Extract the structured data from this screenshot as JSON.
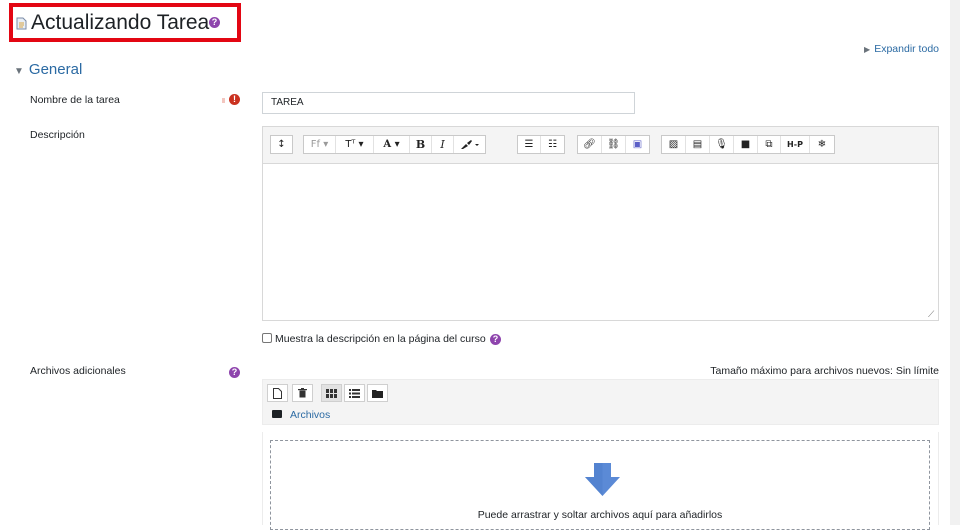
{
  "page": {
    "title": "Actualizando Tarea",
    "expand_all": "Expandir todo",
    "section_general": "General"
  },
  "form": {
    "name_label": "Nombre de la tarea",
    "name_value": "TAREA",
    "description_label": "Descripción",
    "show_description_label": "Muestra la descripción en la página del curso",
    "files_label": "Archivos adicionales",
    "max_size": "Tamaño máximo para archivos nuevos: Sin límite",
    "folder_name": "Archivos",
    "drop_hint": "Puede arrastrar y soltar archivos aquí para añadirlos"
  },
  "toolbar": {
    "font_family_glyph": "Ff ▾",
    "font_size_glyph": "Tᵀ ▾",
    "font_color_glyph": "A ▾",
    "bold_glyph": "B",
    "italic_glyph": "I",
    "h5p_glyph": "H-P"
  },
  "colors": {
    "accent": "#2b6aa3",
    "help": "#8e44ad",
    "required": "#ca3120",
    "highlight": "#e30613"
  }
}
